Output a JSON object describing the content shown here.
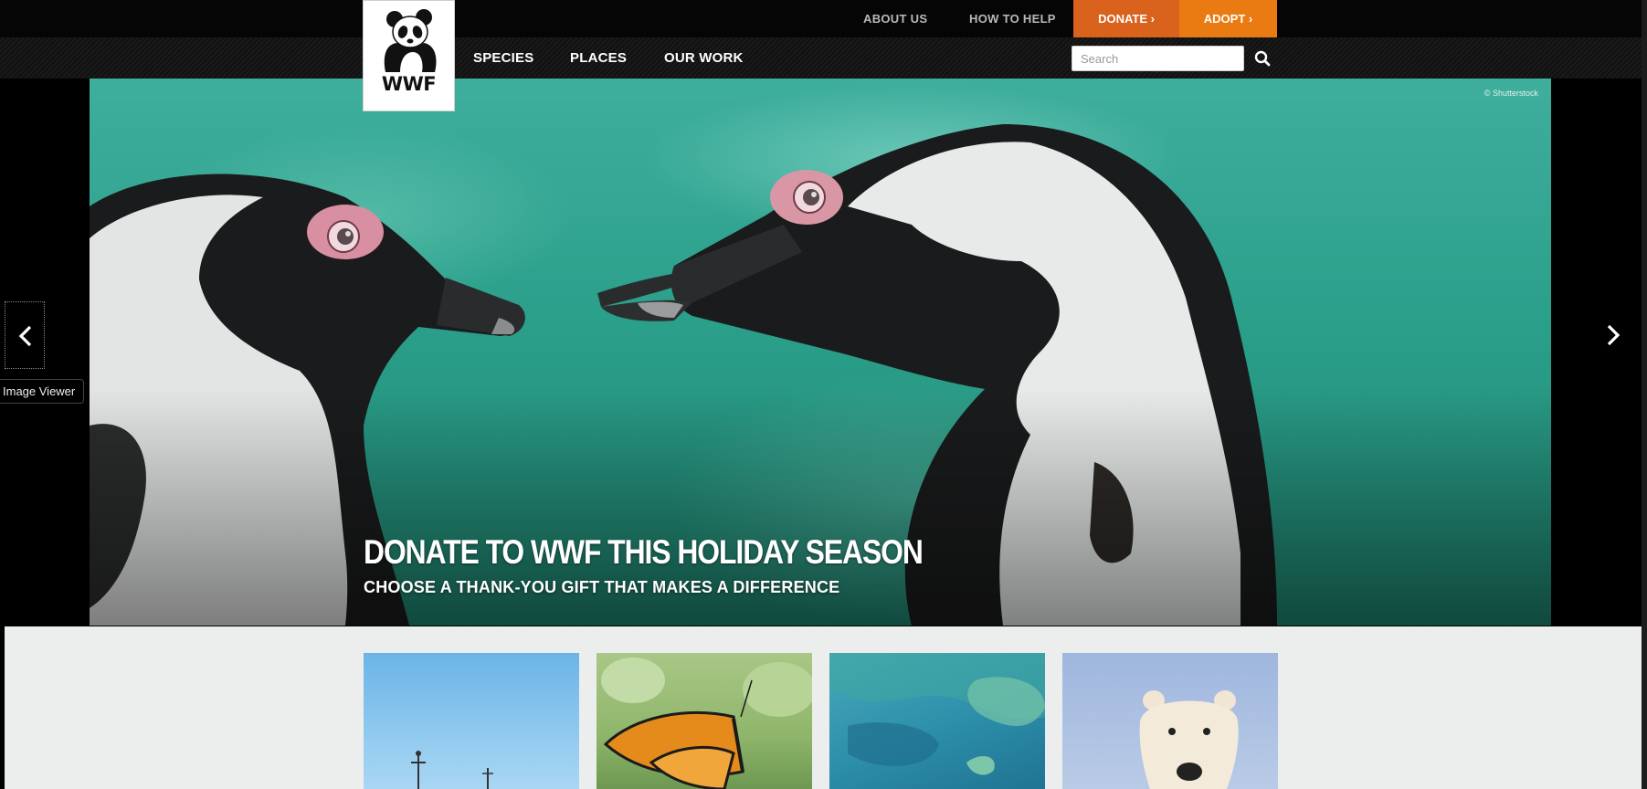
{
  "utility_nav": {
    "about_label": "ABOUT US",
    "help_label": "HOW TO HELP",
    "donate_label": "DONATE ›",
    "adopt_label": "ADOPT ›"
  },
  "main_nav": {
    "items": [
      "SPECIES",
      "PLACES",
      "OUR WORK"
    ]
  },
  "search": {
    "placeholder": "Search",
    "value": ""
  },
  "logo": {
    "text": "WWF"
  },
  "hero": {
    "title": "DONATE TO WWF THIS HOLIDAY SEASON",
    "subtitle": "CHOOSE A THANK-YOU GIFT THAT MAKES A DIFFERENCE",
    "copyright": "© Shutterstock"
  },
  "tooltip": {
    "text": "Image Viewer"
  },
  "icons": {
    "search": "search-icon",
    "prev": "chevron-left-icon",
    "next": "chevron-right-icon",
    "logo": "panda-logo"
  },
  "colors": {
    "donate": "#d9621d",
    "adopt": "#ea7b12",
    "bar": "#050505",
    "cards_background": "#eceeee"
  }
}
